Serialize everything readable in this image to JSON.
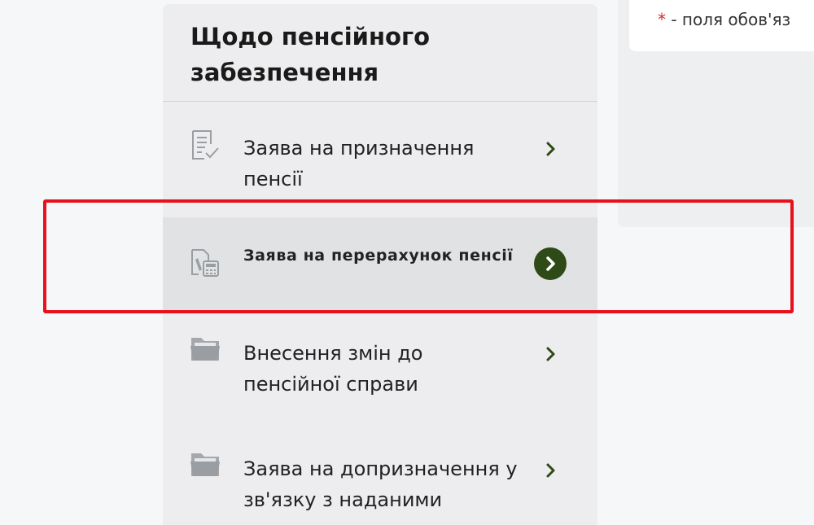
{
  "notice": {
    "star": "*",
    "text": " - поля обов'яз"
  },
  "sidebar": {
    "title": "Щодо пенсійного забезпечення",
    "items": [
      {
        "label": "Заява на призначення пенсії",
        "icon": "document-check-icon",
        "active": false
      },
      {
        "label": "Заява на перерахунок пенсії",
        "icon": "document-calculator-icon",
        "active": true
      },
      {
        "label": "Внесення змін до пенсійної справи",
        "icon": "folder-icon",
        "active": false
      },
      {
        "label": "Заява на допризначення у зв'язку з наданими",
        "icon": "folder-icon",
        "active": false
      }
    ]
  },
  "colors": {
    "accent": "#2e4a17",
    "highlight": "#e8111b",
    "required": "#d32f2f"
  }
}
